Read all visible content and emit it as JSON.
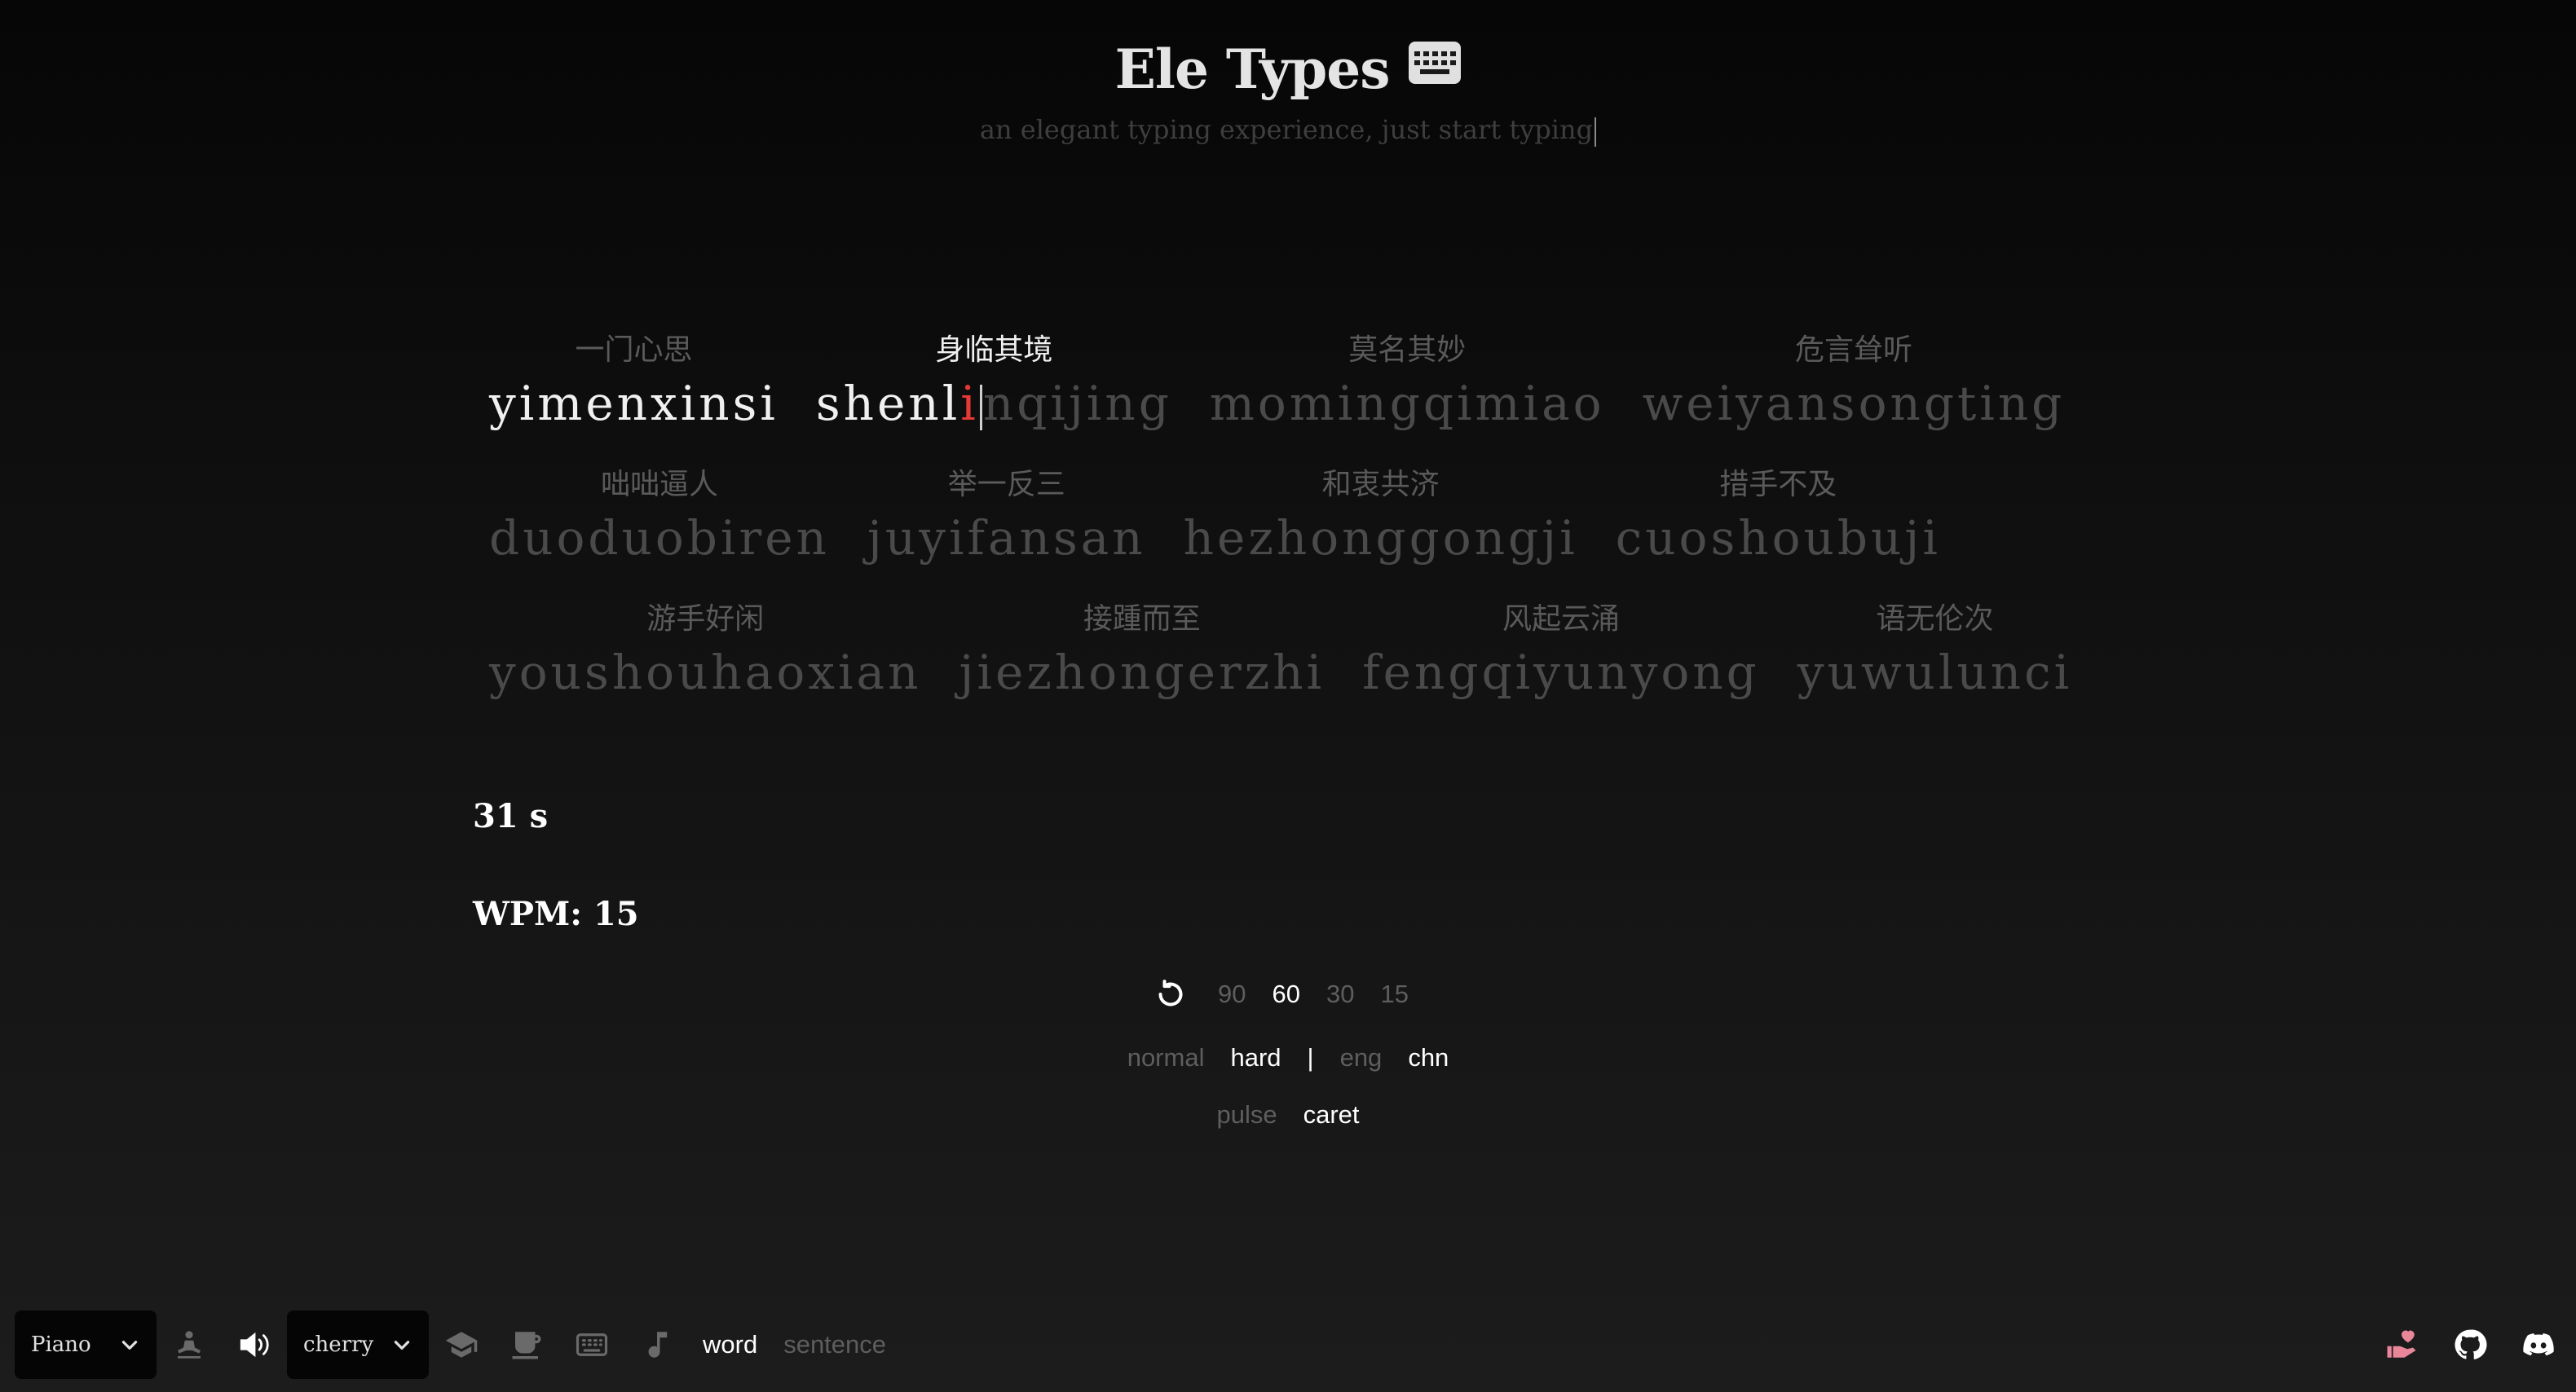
{
  "header": {
    "title": "Ele Types",
    "subtitle": "an elegant typing experience, just start typing"
  },
  "words": [
    [
      {
        "hanzi": "一门心思",
        "pinyin": "yimenxinsi",
        "state": "done"
      },
      {
        "hanzi": "身临其境",
        "pinyin": "shenlinqijing",
        "state": "active",
        "typed": "shenl",
        "wrong": "i",
        "rest": "nqijing"
      },
      {
        "hanzi": "莫名其妙",
        "pinyin": "momingqimiao",
        "state": "pending"
      },
      {
        "hanzi": "危言耸听",
        "pinyin": "weiyansongting",
        "state": "pending"
      }
    ],
    [
      {
        "hanzi": "咄咄逼人",
        "pinyin": "duoduobiren",
        "state": "pending"
      },
      {
        "hanzi": "举一反三",
        "pinyin": "juyifansan",
        "state": "pending"
      },
      {
        "hanzi": "和衷共济",
        "pinyin": "hezhonggongji",
        "state": "pending"
      },
      {
        "hanzi": "措手不及",
        "pinyin": "cuoshoubuji",
        "state": "pending"
      }
    ],
    [
      {
        "hanzi": "游手好闲",
        "pinyin": "youshouhaoxian",
        "state": "pending"
      },
      {
        "hanzi": "接踵而至",
        "pinyin": "jiezhongerzhi",
        "state": "pending"
      },
      {
        "hanzi": "风起云涌",
        "pinyin": "fengqiyunyong",
        "state": "pending"
      },
      {
        "hanzi": "语无伦次",
        "pinyin": "yuwulunci",
        "state": "pending"
      }
    ]
  ],
  "stats": {
    "timer": "31 s",
    "wpm": "WPM: 15"
  },
  "time_options": [
    {
      "label": "90",
      "active": false
    },
    {
      "label": "60",
      "active": true
    },
    {
      "label": "30",
      "active": false
    },
    {
      "label": "15",
      "active": false
    }
  ],
  "difficulty_options": [
    {
      "label": "normal",
      "active": false
    },
    {
      "label": "hard",
      "active": true
    }
  ],
  "separator": "|",
  "language_options": [
    {
      "label": "eng",
      "active": false
    },
    {
      "label": "chn",
      "active": true
    }
  ],
  "caret_options": [
    {
      "label": "pulse",
      "active": false
    },
    {
      "label": "caret",
      "active": true
    }
  ],
  "bottom_bar": {
    "sound_select": "Piano",
    "theme_select": "cherry",
    "modes": [
      {
        "label": "word",
        "active": true
      },
      {
        "label": "sentence",
        "active": false
      }
    ]
  },
  "colors": {
    "text_active": "#ffffff",
    "text_pending": "#4a4a4a",
    "error": "#e53935",
    "donate_pink": "#e8869a"
  },
  "icons": [
    "keyboard-icon",
    "reset-icon",
    "chevron-down-icon",
    "zen-meditation-icon",
    "volume-icon",
    "graduation-cap-icon",
    "coffee-icon",
    "keyboard-icon",
    "music-note-icon",
    "donate-heart-icon",
    "github-icon",
    "discord-icon"
  ]
}
